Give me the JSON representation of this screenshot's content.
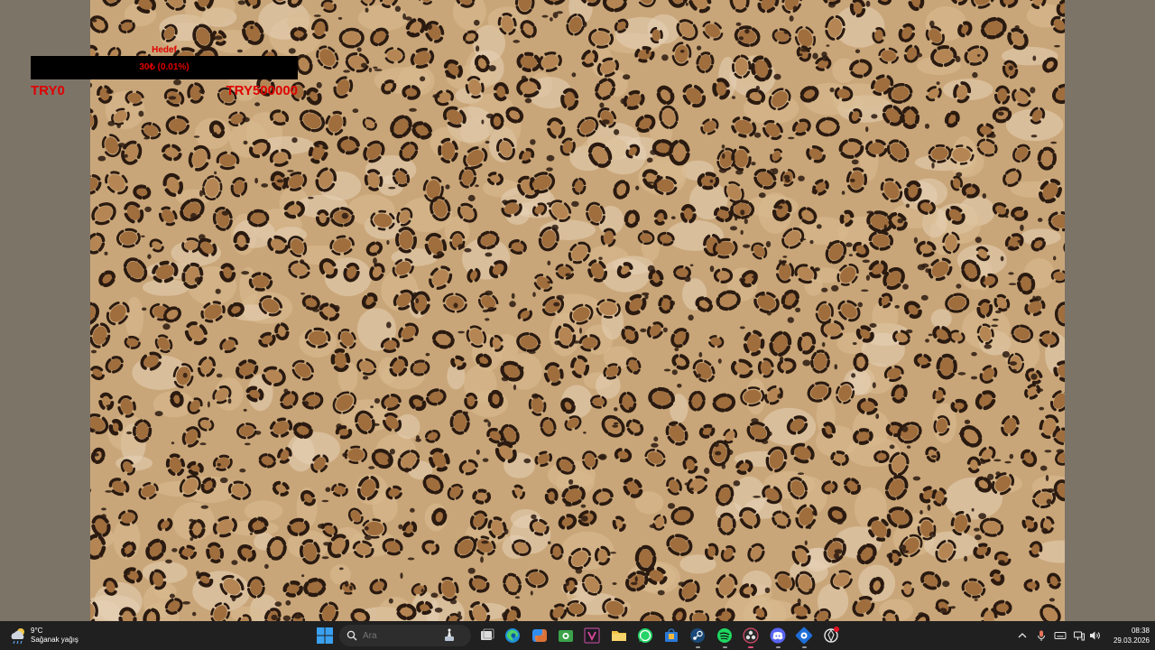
{
  "goal_widget": {
    "title": "Hedef",
    "progress_label": "30₺ (0.01%)",
    "progress_fraction": 0.0001,
    "min_label": "TRY0",
    "max_label": "TRY500000",
    "accent_color": "#e00000"
  },
  "wallpaper": {
    "pattern": "leopard-print",
    "base_color": "#c9a679"
  },
  "taskbar": {
    "weather": {
      "temperature": "9°C",
      "description": "Sağanak yağış",
      "icon": "rain-cloud-icon"
    },
    "search": {
      "placeholder": "Ara"
    },
    "pinned_apps": [
      {
        "name": "start",
        "icon": "windows-logo-icon"
      },
      {
        "name": "task-view",
        "icon": "task-view-icon"
      },
      {
        "name": "edge",
        "icon": "edge-icon"
      },
      {
        "name": "copilot",
        "icon": "copilot-icon"
      },
      {
        "name": "app-green",
        "icon": "camera-app-icon"
      },
      {
        "name": "app-purple",
        "icon": "visual-studio-icon"
      },
      {
        "name": "file-explorer",
        "icon": "folder-icon"
      },
      {
        "name": "whatsapp",
        "icon": "whatsapp-icon"
      },
      {
        "name": "store",
        "icon": "store-bag-icon"
      },
      {
        "name": "steam",
        "icon": "steam-icon"
      },
      {
        "name": "spotify",
        "icon": "spotify-icon"
      },
      {
        "name": "obs",
        "icon": "obs-icon"
      },
      {
        "name": "discord",
        "icon": "discord-icon"
      },
      {
        "name": "app-blue",
        "icon": "gear-app-icon"
      },
      {
        "name": "chatgpt",
        "icon": "chatgpt-icon"
      }
    ],
    "clock": {
      "time": "08:38",
      "date": "29.03.2026"
    }
  }
}
